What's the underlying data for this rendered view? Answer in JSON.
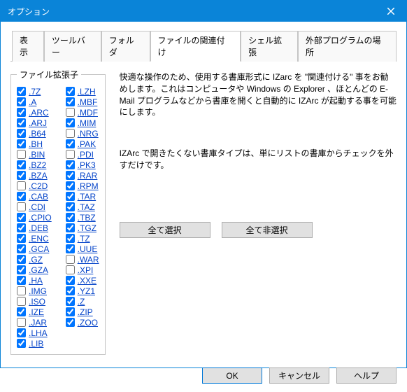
{
  "title": "オプション",
  "tabs": [
    "表示",
    "ツールバー",
    "フォルダ",
    "ファイルの関連付け",
    "シェル拡張",
    "外部プログラムの場所"
  ],
  "active_tab_index": 3,
  "fieldset_legend": "ファイル拡張子",
  "extensions": [
    [
      {
        "label": ".7Z",
        "checked": true
      },
      {
        "label": ".A",
        "checked": true
      },
      {
        "label": ".ARC",
        "checked": true
      },
      {
        "label": ".ARJ",
        "checked": true
      },
      {
        "label": ".B64",
        "checked": true
      },
      {
        "label": ".BH",
        "checked": true
      },
      {
        "label": ".BIN",
        "checked": false
      },
      {
        "label": ".BZ2",
        "checked": true
      },
      {
        "label": ".BZA",
        "checked": true
      },
      {
        "label": ".C2D",
        "checked": false
      },
      {
        "label": ".CAB",
        "checked": true
      },
      {
        "label": ".CDI",
        "checked": false
      },
      {
        "label": ".CPIO",
        "checked": true
      },
      {
        "label": ".DEB",
        "checked": true
      },
      {
        "label": ".ENC",
        "checked": true
      },
      {
        "label": ".GCA",
        "checked": true
      },
      {
        "label": ".GZ",
        "checked": true
      },
      {
        "label": ".GZA",
        "checked": true
      },
      {
        "label": ".HA",
        "checked": true
      },
      {
        "label": ".IMG",
        "checked": false
      },
      {
        "label": ".ISO",
        "checked": false
      },
      {
        "label": ".IZE",
        "checked": true
      },
      {
        "label": ".JAR",
        "checked": false
      },
      {
        "label": ".LHA",
        "checked": true
      },
      {
        "label": ".LIB",
        "checked": true
      }
    ],
    [
      {
        "label": ".LZH",
        "checked": true
      },
      {
        "label": ".MBF",
        "checked": true
      },
      {
        "label": ".MDF",
        "checked": false
      },
      {
        "label": ".MIM",
        "checked": true
      },
      {
        "label": ".NRG",
        "checked": false
      },
      {
        "label": ".PAK",
        "checked": true
      },
      {
        "label": ".PDI",
        "checked": false
      },
      {
        "label": ".PK3",
        "checked": true
      },
      {
        "label": ".RAR",
        "checked": true
      },
      {
        "label": ".RPM",
        "checked": true
      },
      {
        "label": ".TAR",
        "checked": true
      },
      {
        "label": ".TAZ",
        "checked": true
      },
      {
        "label": ".TBZ",
        "checked": true
      },
      {
        "label": ".TGZ",
        "checked": true
      },
      {
        "label": ".TZ",
        "checked": true
      },
      {
        "label": ".UUE",
        "checked": true
      },
      {
        "label": ".WAR",
        "checked": false
      },
      {
        "label": ".XPI",
        "checked": false
      },
      {
        "label": ".XXE",
        "checked": true
      },
      {
        "label": ".YZ1",
        "checked": true
      },
      {
        "label": ".Z",
        "checked": true
      },
      {
        "label": ".ZIP",
        "checked": true
      },
      {
        "label": ".ZOO",
        "checked": true
      }
    ]
  ],
  "desc1": "快適な操作のため、使用する書庫形式に IZarc を \"関連付ける\" 事をお勧めします。これはコンピュータや Windows の Explorer 、ほとんどの E-Mail プログラムなどから書庫を開くと自動的に IZArc が起動する事を可能にします。",
  "desc2": "IZArc で開きたくない書庫タイプは、単にリストの書庫からチェックを外すだけです。",
  "btn_select_all": "全て選択",
  "btn_deselect_all": "全て非選択",
  "btn_ok": "OK",
  "btn_cancel": "キャンセル",
  "btn_help": "ヘルプ"
}
